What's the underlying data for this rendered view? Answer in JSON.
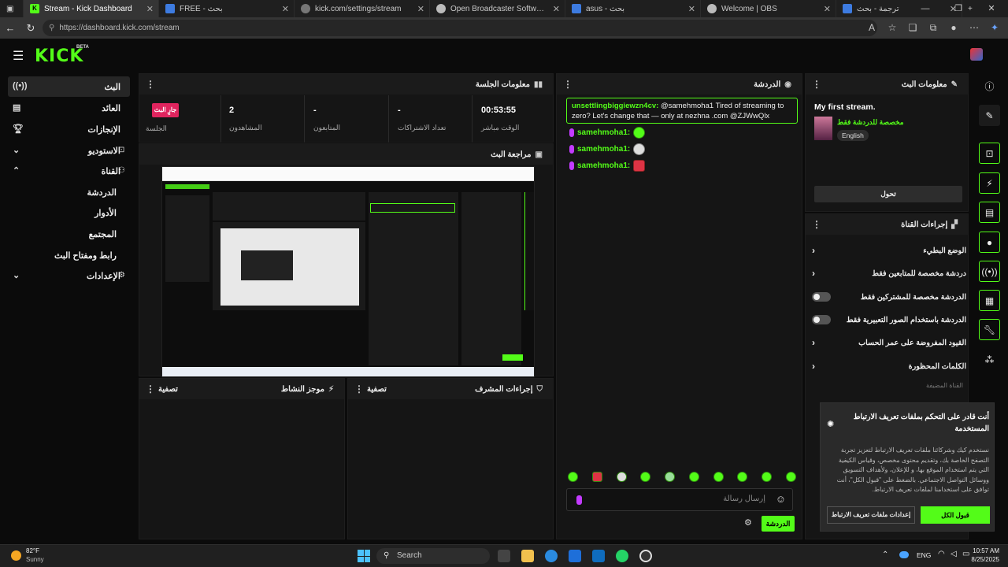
{
  "browser": {
    "tabs": [
      {
        "title": "Stream - Kick Dashboard",
        "active": true,
        "icon": "kick-favicon"
      },
      {
        "title": "FREE - بحث",
        "icon": "search-favicon"
      },
      {
        "title": "kick.com/settings/stream",
        "icon": "globe-favicon"
      },
      {
        "title": "Open Broadcaster Software | OBS",
        "icon": "obs-favicon"
      },
      {
        "title": "asus - بحث",
        "icon": "search-favicon"
      },
      {
        "title": "Welcome | OBS",
        "icon": "obs-favicon"
      },
      {
        "title": "ترجمة - بحث",
        "icon": "search-favicon"
      }
    ],
    "url": "https://dashboard.kick.com/stream"
  },
  "kick": {
    "logo": "KICK",
    "beta": "BETA"
  },
  "sidebar": {
    "items": [
      {
        "label": "البث",
        "icon": "broadcast-icon",
        "active": true
      },
      {
        "label": "العائد",
        "icon": "chart-icon"
      },
      {
        "label": "الإنجازات",
        "icon": "trophy-icon"
      },
      {
        "label": "الاستوديو",
        "icon": "studio-icon"
      },
      {
        "label": "القناة",
        "icon": "chevron-up-icon"
      }
    ],
    "channel_sub": [
      "الدردشة",
      "الأدوار",
      "المجتمع",
      "رابط ومفتاح البث"
    ],
    "settings": "الإعدادات"
  },
  "session": {
    "title": "معلومات الجلسة",
    "live_button": "جارٍ البث",
    "session_label": "الجلسة",
    "stats": [
      {
        "value": "2",
        "label": "المشاهدون"
      },
      {
        "value": "-",
        "label": "المتابعون"
      },
      {
        "value": "-",
        "label": "تعداد الاشتراكات"
      },
      {
        "value": "00:53:55",
        "label": "الوقت مباشر"
      }
    ]
  },
  "preview": {
    "title": "مراجعة البث"
  },
  "activity": {
    "title": "موجز النشاط",
    "filter": "تصفية"
  },
  "mod": {
    "title": "إجراءات المشرف",
    "filter": "تصفية"
  },
  "chat": {
    "title": "الدردشة",
    "pinned": {
      "user": "unsettlingbiggiewzn4cv:",
      "text": "@samehmoha1 Tired of streaming to zero? Let's change that — only at nezhna .com @ZJWwQlx"
    },
    "messages": [
      {
        "user": "samehmoha1:"
      },
      {
        "user": "samehmoha1:"
      },
      {
        "user": "samehmoha1:"
      }
    ],
    "input_placeholder": "إرسال رسالة",
    "send_button": "الدردشة"
  },
  "stream_info": {
    "title": "معلومات البث",
    "stream_title": "My first stream.",
    "category": "مخصصة للدردشة فقط",
    "language": "English",
    "edit_button": "تحول"
  },
  "channel_actions": {
    "title": "إجراءات القناة",
    "items": [
      {
        "label": "الوضع البطيء",
        "control": "chevron"
      },
      {
        "label": "دردشة مخصصة للمتابعين فقط",
        "control": "chevron"
      },
      {
        "label": "الدردشة مخصصة للمشتركين فقط",
        "control": "toggle"
      },
      {
        "label": "الدردشة باستخدام الصور التعبيرية فقط",
        "control": "toggle"
      },
      {
        "label": "القيود المفروضة على عمر الحساب",
        "control": "chevron"
      },
      {
        "label": "الكلمات المحظورة",
        "control": "chevron"
      }
    ],
    "more": "القناة المضيفة"
  },
  "cookie": {
    "title": "أنت قادر على التحكم بملفات تعريف الارتباط المستخدمة",
    "body": "نستخدم كيك وشركائنا ملفات تعريف الارتباط لتعزيز تجربة التصفح الخاصة بك، وتقديم محتوى مخصص، وقياس الكيفية التي يتم استخدام الموقع بها، و للإعلان، ولأهداف التسويق ووسائل التواصل الاجتماعي. بالضغط على \"قبول الكل\"، أنت توافق على استخدامنا لملفات تعريف الارتباط.",
    "settings_button": "إعدادات ملفات تعريف الارتباط",
    "accept_button": "قبول الكل"
  },
  "taskbar": {
    "weather_temp": "82°F",
    "weather_text": "Sunny",
    "search": "Search",
    "lang": "ENG",
    "time": "10:57 AM",
    "date": "8/25/2025"
  },
  "colors": {
    "accent": "#53fc18",
    "live": "#e0245e",
    "badge": "#c33bff"
  }
}
